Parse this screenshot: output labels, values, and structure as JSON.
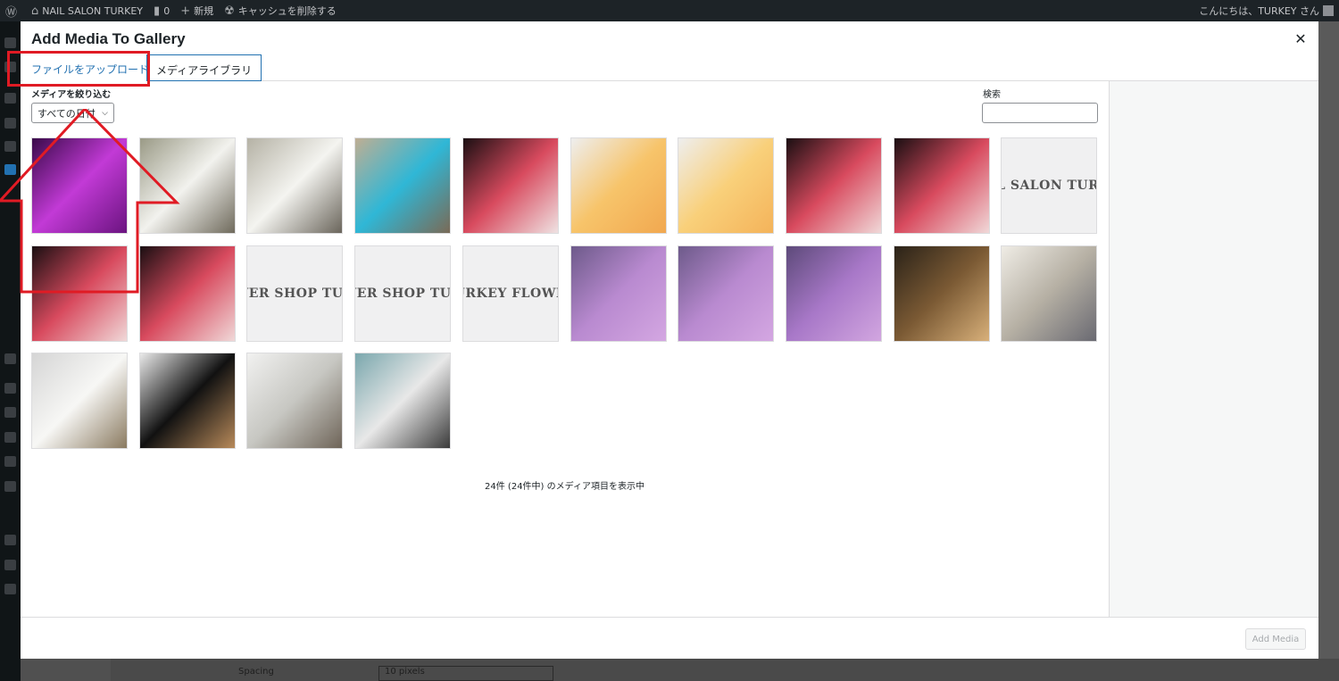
{
  "adminbar": {
    "site_name": "NAIL SALON TURKEY",
    "comments_count": "0",
    "new_label": "新規",
    "cache_label": "キャッシュを削除する",
    "greeting": "こんにちは、TURKEY さん"
  },
  "background": {
    "spacing_label": "Spacing",
    "spacing_value": "10 pixels"
  },
  "modal": {
    "title": "Add Media To Gallery",
    "tabs": [
      {
        "label": "ファイルをアップロード"
      },
      {
        "label": "メディアライブラリ"
      }
    ],
    "filter_label": "メディアを絞り込む",
    "date_filter_value": "すべての日付",
    "search_label": "検索",
    "search_value": "",
    "count_text": "24件 (24件中) のメディア項目を表示中",
    "add_media_label": "Add Media"
  },
  "thumbnails": [
    {
      "kind": "photo",
      "colors": [
        "#3a0a4a",
        "#c23ad6",
        "#6b1480"
      ]
    },
    {
      "kind": "photo",
      "colors": [
        "#9a9a86",
        "#f2f2ee",
        "#6f6a5c"
      ]
    },
    {
      "kind": "photo",
      "colors": [
        "#b5b2a5",
        "#f4f4f0",
        "#6a655b"
      ]
    },
    {
      "kind": "photo",
      "colors": [
        "#bfae93",
        "#2fb7d6",
        "#7a6a56"
      ]
    },
    {
      "kind": "photo",
      "colors": [
        "#1a0f12",
        "#d84a5e",
        "#efe2e2"
      ]
    },
    {
      "kind": "photo",
      "colors": [
        "#eeeeee",
        "#f7c46a",
        "#f1a850"
      ]
    },
    {
      "kind": "photo",
      "colors": [
        "#eeeeee",
        "#f9d07a",
        "#f4b35a"
      ]
    },
    {
      "kind": "photo",
      "colors": [
        "#1a0f12",
        "#d84a5e",
        "#f0d8d8"
      ]
    },
    {
      "kind": "photo",
      "colors": [
        "#1a0f12",
        "#d84a5e",
        "#f0d8d8"
      ]
    },
    {
      "kind": "text",
      "text": "NAIL SALON TURKEY"
    },
    {
      "kind": "photo",
      "colors": [
        "#1a0f12",
        "#d84a5e",
        "#f0d8d8"
      ]
    },
    {
      "kind": "photo",
      "colors": [
        "#1a0f12",
        "#d84a5e",
        "#f0d8d8"
      ]
    },
    {
      "kind": "text",
      "text": "FLOWER SHOP TURKEY"
    },
    {
      "kind": "text",
      "text": "FLOWER SHOP TURKEY"
    },
    {
      "kind": "text",
      "text": "TURKEY FLOWER"
    },
    {
      "kind": "photo",
      "colors": [
        "#6d5a8a",
        "#b98ad0",
        "#d4a7e2"
      ]
    },
    {
      "kind": "photo",
      "colors": [
        "#6d5a8a",
        "#b98ad0",
        "#d4a7e2"
      ]
    },
    {
      "kind": "photo",
      "colors": [
        "#5d4a7a",
        "#a878c8",
        "#d2a6e0"
      ]
    },
    {
      "kind": "photo",
      "colors": [
        "#2a2218",
        "#7b5a34",
        "#d8b07a"
      ]
    },
    {
      "kind": "photo",
      "colors": [
        "#efece5",
        "#b6b0a4",
        "#6a6a72"
      ]
    },
    {
      "kind": "photo",
      "colors": [
        "#d5d5d5",
        "#f7f7f5",
        "#8a7a60"
      ]
    },
    {
      "kind": "photo",
      "colors": [
        "#e9e9e9",
        "#111111",
        "#b88a5a"
      ]
    },
    {
      "kind": "photo",
      "colors": [
        "#f1f1f0",
        "#c7c7c2",
        "#6e6458"
      ]
    },
    {
      "kind": "photo",
      "colors": [
        "#7aa7ad",
        "#e8e8e8",
        "#3a3a3a"
      ]
    }
  ],
  "colors": {
    "accent": "#2271b1",
    "annotation": "#e01b24"
  }
}
